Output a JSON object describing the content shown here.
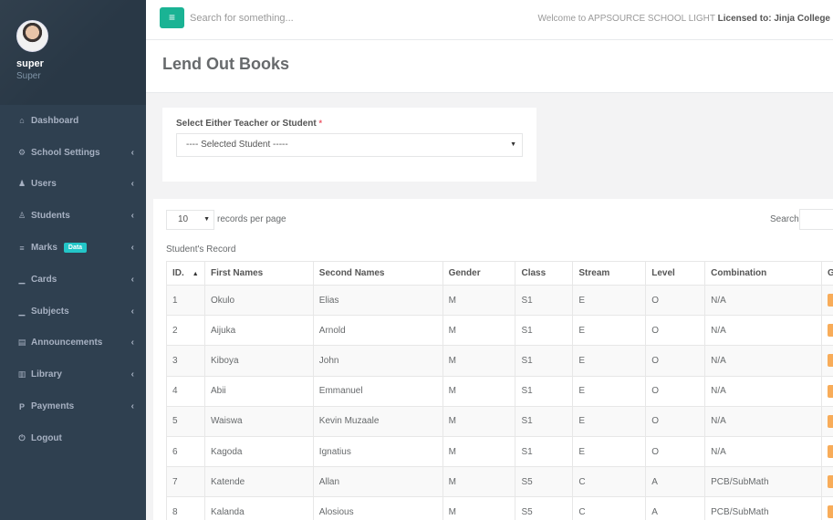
{
  "profile": {
    "name": "super",
    "role": "Super"
  },
  "nav": [
    {
      "label": "Dashboard",
      "icon": "⌂",
      "arrow": ""
    },
    {
      "label": "School Settings",
      "icon": "⚙",
      "arrow": "‹"
    },
    {
      "label": "Users",
      "icon": "♟",
      "arrow": "‹"
    },
    {
      "label": "Students",
      "icon": "♙",
      "arrow": "‹"
    },
    {
      "label": "Marks",
      "icon": "≡",
      "arrow": "‹",
      "badge": "Data"
    },
    {
      "label": "Cards",
      "icon": "▁",
      "arrow": "‹"
    },
    {
      "label": "Subjects",
      "icon": "▁",
      "arrow": "‹"
    },
    {
      "label": "Announcements",
      "icon": "▤",
      "arrow": "‹"
    },
    {
      "label": "Library",
      "icon": "▥",
      "arrow": "‹"
    },
    {
      "label": "Payments",
      "icon": "P",
      "arrow": "‹"
    },
    {
      "label": "Logout",
      "icon": "⏻",
      "arrow": ""
    }
  ],
  "topbar": {
    "menu_icon": "≡",
    "search_placeholder": "Search for something...",
    "welcome_text": "Welcome to APPSOURCE SCHOOL LIGHT",
    "licensed_label": "Licensed to:",
    "licensee": "Jinja College"
  },
  "page": {
    "title": "Lend Out Books"
  },
  "selector": {
    "label": "Select Either Teacher or Student",
    "required_mark": "*",
    "value": "---- Selected Student -----"
  },
  "table_controls": {
    "page_length": "10",
    "length_suffix": "records per page",
    "search_label": "Search:",
    "caption": "Student's Record"
  },
  "table": {
    "headers": [
      "ID.",
      "First Names",
      "Second Names",
      "Gender",
      "Class",
      "Stream",
      "Level",
      "Combination",
      "G"
    ],
    "rows": [
      [
        "1",
        "Okulo",
        "Elias",
        "M",
        "S1",
        "E",
        "O",
        "N/A"
      ],
      [
        "2",
        "Aijuka",
        "Arnold",
        "M",
        "S1",
        "E",
        "O",
        "N/A"
      ],
      [
        "3",
        "Kiboya",
        "John",
        "M",
        "S1",
        "E",
        "O",
        "N/A"
      ],
      [
        "4",
        "Abii",
        "Emmanuel",
        "M",
        "S1",
        "E",
        "O",
        "N/A"
      ],
      [
        "5",
        "Waiswa",
        "Kevin Muzaale",
        "M",
        "S1",
        "E",
        "O",
        "N/A"
      ],
      [
        "6",
        "Kagoda",
        "Ignatius",
        "M",
        "S1",
        "E",
        "O",
        "N/A"
      ],
      [
        "7",
        "Katende",
        "Allan",
        "M",
        "S5",
        "C",
        "A",
        "PCB/SubMath"
      ],
      [
        "8",
        "Kalanda",
        "Alosious",
        "M",
        "S5",
        "C",
        "A",
        "PCB/SubMath"
      ]
    ]
  },
  "colors": {
    "sidebar": "#2f4050",
    "accent": "#1ab394",
    "badge": "#23c6c8",
    "action": "#f8ac59"
  }
}
